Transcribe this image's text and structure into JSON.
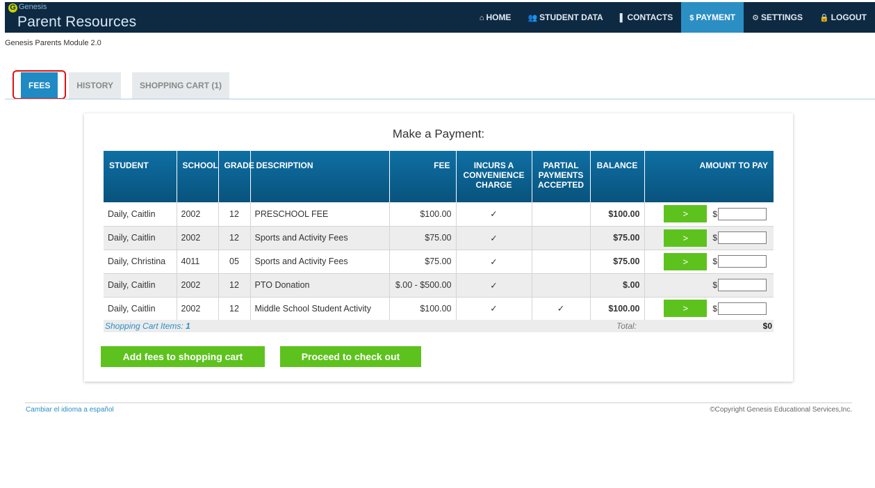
{
  "header": {
    "logo_small": "Genesis",
    "logo_mark": "G",
    "title": "Parent Resources",
    "nav": [
      {
        "label": "HOME",
        "icon": "⌂"
      },
      {
        "label": "STUDENT DATA",
        "icon": "👥"
      },
      {
        "label": "CONTACTS",
        "icon": "▌"
      },
      {
        "label": "PAYMENT",
        "icon": "$"
      },
      {
        "label": "SETTINGS",
        "icon": "⚙"
      },
      {
        "label": "LOGOUT",
        "icon": "🔒"
      }
    ],
    "active_nav": "PAYMENT",
    "colors": {
      "bar": "#0e2a42",
      "active": "#2b8fc4"
    }
  },
  "module_label": "Genesis Parents Module 2.0",
  "tabs": [
    {
      "label": "FEES",
      "active": true
    },
    {
      "label": "HISTORY",
      "active": false
    },
    {
      "label": "SHOPPING CART (1)",
      "active": false
    }
  ],
  "payment": {
    "title": "Make a Payment:",
    "columns": [
      "STUDENT",
      "SCHOOL",
      "GRADE",
      "DESCRIPTION",
      "FEE",
      "INCURS A CONVENIENCE CHARGE",
      "PARTIAL PAYMENTS ACCEPTED",
      "BALANCE",
      "AMOUNT TO PAY"
    ],
    "rows": [
      {
        "student": "Daily, Caitlin",
        "school": "2002",
        "grade": "12",
        "description": "PRESCHOOL FEE",
        "fee": "$100.00",
        "convenience": "✓",
        "partial": "",
        "balance": "$100.00",
        "button": ">",
        "currency": "$",
        "amount": ""
      },
      {
        "student": "Daily, Caitlin",
        "school": "2002",
        "grade": "12",
        "description": "Sports and Activity Fees",
        "fee": "$75.00",
        "convenience": "✓",
        "partial": "",
        "balance": "$75.00",
        "button": ">",
        "currency": "$",
        "amount": ""
      },
      {
        "student": "Daily, Christina",
        "school": "4011",
        "grade": "05",
        "description": "Sports and Activity Fees",
        "fee": "$75.00",
        "convenience": "✓",
        "partial": "",
        "balance": "$75.00",
        "button": ">",
        "currency": "$",
        "amount": ""
      },
      {
        "student": "Daily, Caitlin",
        "school": "2002",
        "grade": "12",
        "description": "PTO Donation",
        "fee": "$.00 - $500.00",
        "convenience": "✓",
        "partial": "",
        "balance": "$.00",
        "button": "",
        "currency": "$",
        "amount": ""
      },
      {
        "student": "Daily, Caitlin",
        "school": "2002",
        "grade": "12",
        "description": "Middle School Student Activity",
        "fee": "$100.00",
        "convenience": "✓",
        "partial": "✓",
        "balance": "$100.00",
        "button": ">",
        "currency": "$",
        "amount": ""
      }
    ],
    "cart_items_label": "Shopping Cart Items: ",
    "cart_items_count": "1",
    "total_label": "Total:",
    "total_value": "$0",
    "add_button": "Add fees to shopping cart",
    "checkout_button": "Proceed to check out",
    "colors": {
      "header": "#0f6fa3",
      "button": "#5ec21e"
    }
  },
  "footer": {
    "language_link": "Cambiar el idioma a español",
    "copyright": "©Copyright Genesis Educational Services,Inc."
  }
}
